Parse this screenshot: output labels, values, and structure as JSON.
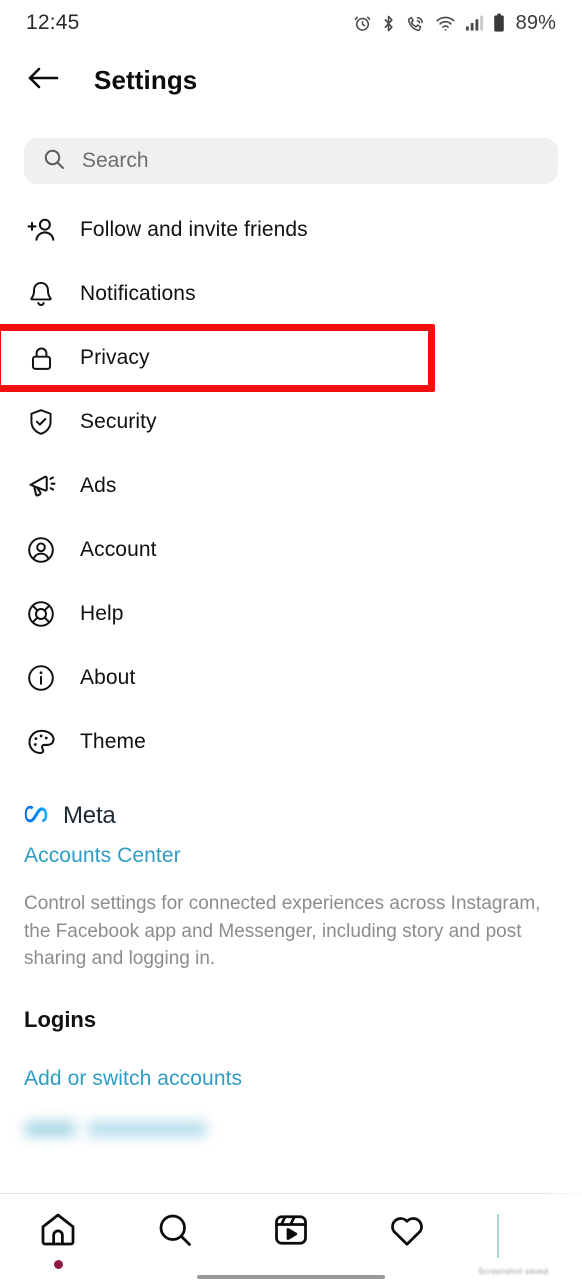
{
  "status_bar": {
    "time": "12:45",
    "battery_percent": "89%",
    "icons": [
      "alarm-icon",
      "bluetooth-icon",
      "wifi-calling-icon",
      "wifi-icon",
      "cellular-signal-icon",
      "battery-icon"
    ]
  },
  "header": {
    "title": "Settings",
    "back_icon": "back-arrow-icon"
  },
  "search": {
    "placeholder": "Search",
    "icon": "search-icon"
  },
  "menu": {
    "items": [
      {
        "label": "Follow and invite friends",
        "icon": "add-person-icon"
      },
      {
        "label": "Notifications",
        "icon": "bell-icon"
      },
      {
        "label": "Privacy",
        "icon": "lock-icon",
        "highlighted": true
      },
      {
        "label": "Security",
        "icon": "shield-check-icon"
      },
      {
        "label": "Ads",
        "icon": "megaphone-icon"
      },
      {
        "label": "Account",
        "icon": "person-circle-icon"
      },
      {
        "label": "Help",
        "icon": "life-ring-icon"
      },
      {
        "label": "About",
        "icon": "info-circle-icon"
      },
      {
        "label": "Theme",
        "icon": "paint-palette-icon"
      }
    ]
  },
  "meta_section": {
    "brand": "Meta",
    "logo_icon": "meta-infinity-icon",
    "accounts_center_link": "Accounts Center",
    "description": "Control settings for connected experiences across Instagram, the Facebook app and Messenger, including story and post sharing and logging in."
  },
  "logins_section": {
    "heading": "Logins",
    "add_switch_link": "Add or switch accounts",
    "account_name": ""
  },
  "bottom_nav": {
    "items": [
      {
        "label": "Home",
        "icon": "home-icon",
        "has_badge": true
      },
      {
        "label": "Search",
        "icon": "search-icon",
        "has_badge": false
      },
      {
        "label": "Reels",
        "icon": "reels-icon",
        "has_badge": false
      },
      {
        "label": "Activity",
        "icon": "heart-icon",
        "has_badge": false
      },
      {
        "label": "Profile",
        "icon": "profile-avatar-icon",
        "has_badge": false
      }
    ],
    "tiny_text": "Screenshot saved"
  },
  "colors": {
    "highlight_red": "#f10f0f",
    "link_blue": "#2f9cc4",
    "meta_blue": "#0082fb",
    "badge_red": "#8d1b3d",
    "search_bg": "#f0f0f0",
    "muted_text": "#8c8c8c"
  }
}
